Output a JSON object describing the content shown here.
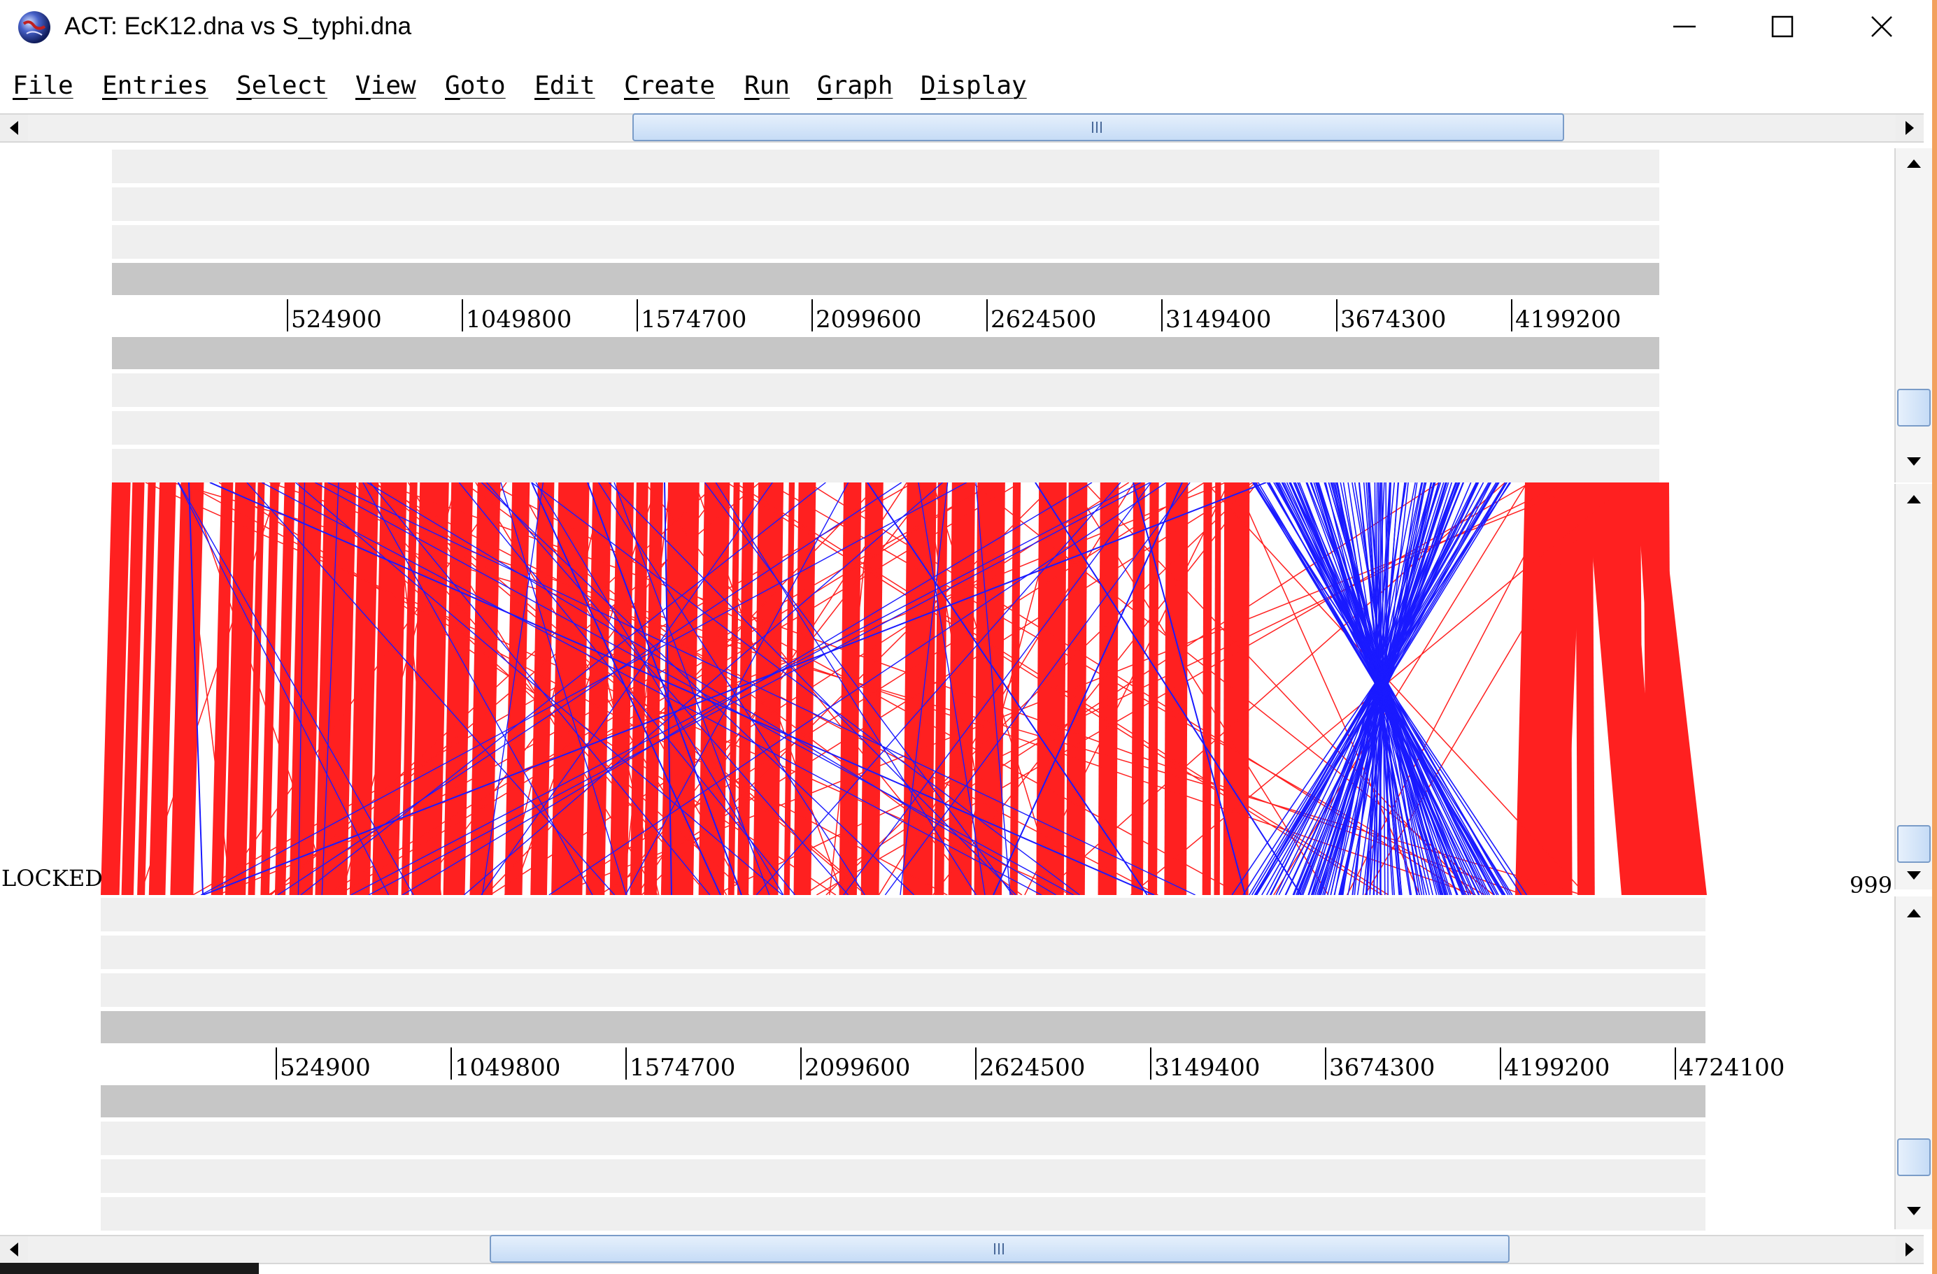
{
  "window": {
    "title": "ACT: EcK12.dna vs S_typhi.dna",
    "controls": {
      "minimize": "—",
      "maximize": "☐",
      "close": "✕"
    }
  },
  "menu": [
    "File",
    "Entries",
    "Select",
    "View",
    "Goto",
    "Edit",
    "Create",
    "Run",
    "Graph",
    "Display"
  ],
  "top_ruler": {
    "ticks": [
      "524900",
      "1049800",
      "1574700",
      "2099600",
      "2624500",
      "3149400",
      "3674300",
      "4199200"
    ]
  },
  "bottom_ruler": {
    "ticks": [
      "524900",
      "1049800",
      "1574700",
      "2099600",
      "2624500",
      "3149400",
      "3674300",
      "4199200",
      "4724100"
    ]
  },
  "comparison": {
    "locked_label": "LOCKED",
    "right_label": "999",
    "colors": {
      "forward_match": "#ff2020",
      "reverse_match": "#1a1aff"
    }
  },
  "scrollbars": {
    "top_horizontal": {
      "thumb_start": 0.325,
      "thumb_end": 0.808
    },
    "bottom_horizontal": {
      "thumb_start": 0.252,
      "thumb_end": 0.783
    }
  }
}
